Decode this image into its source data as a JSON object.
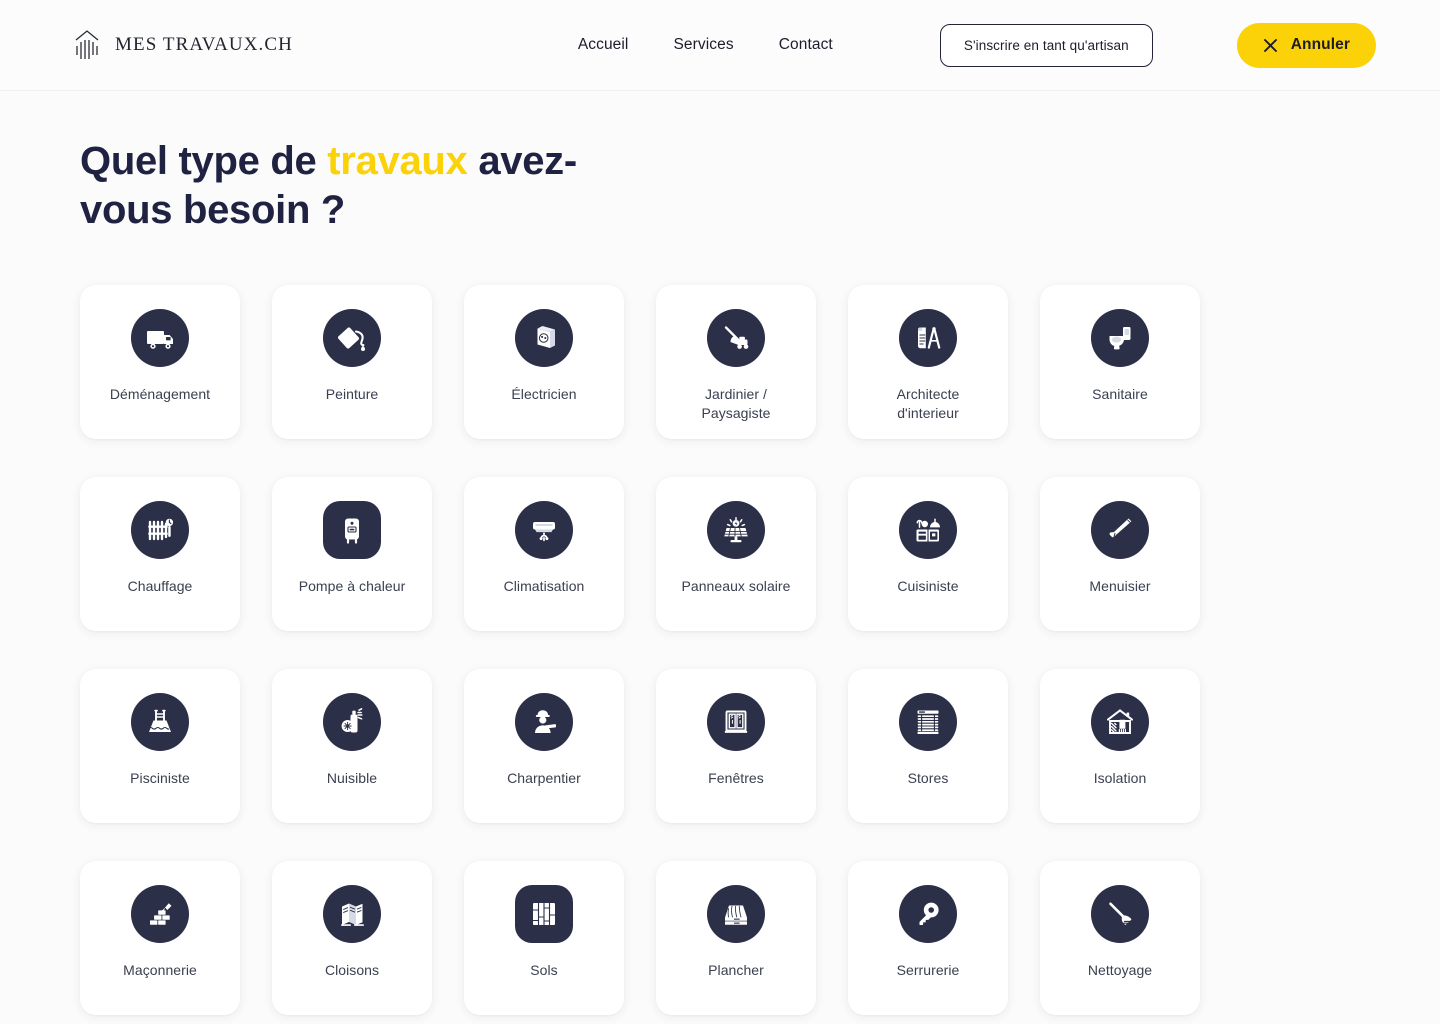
{
  "brand": {
    "name": "MES TRAVAUX.CH",
    "logo_icon": "building-icon"
  },
  "nav": {
    "links": [
      {
        "label": "Accueil",
        "name": "nav-link-accueil"
      },
      {
        "label": "Services",
        "name": "nav-link-services"
      },
      {
        "label": "Contact",
        "name": "nav-link-contact"
      }
    ],
    "signup_button": "S'inscrire en tant qu'artisan",
    "cancel_button": "Annuler",
    "cancel_icon": "close-icon"
  },
  "colors": {
    "accent_yellow": "#fad207",
    "icon_navy": "#2b2f47",
    "heading_navy": "#1f2240",
    "page_background": "#fbfbfc",
    "card_background": "#ffffff",
    "label_text": "#3b4050"
  },
  "main": {
    "title_part1": "Quel type de ",
    "title_accent": "travaux",
    "title_part2": " avez-vous besoin ?"
  },
  "categories": [
    {
      "label": "Déménagement",
      "icon": "moving-truck-icon",
      "shape": "circle"
    },
    {
      "label": "Peinture",
      "icon": "paint-can-icon",
      "shape": "circle"
    },
    {
      "label": "Électricien",
      "icon": "power-socket-icon",
      "shape": "circle"
    },
    {
      "label": "Jardinier /\nPaysagiste",
      "icon": "lawn-mower-icon",
      "shape": "circle"
    },
    {
      "label": "Architecte\nd'interieur",
      "icon": "blueprint-compass-icon",
      "shape": "circle"
    },
    {
      "label": "Sanitaire",
      "icon": "toilet-icon",
      "shape": "circle"
    },
    {
      "label": "Chauffage",
      "icon": "radiator-icon",
      "shape": "circle"
    },
    {
      "label": "Pompe à chaleur",
      "icon": "water-heater-icon",
      "shape": "squircle"
    },
    {
      "label": "Climatisation",
      "icon": "air-conditioner-icon",
      "shape": "circle"
    },
    {
      "label": "Panneaux solaire",
      "icon": "solar-panel-icon",
      "shape": "circle"
    },
    {
      "label": "Cuisiniste",
      "icon": "kitchen-counter-icon",
      "shape": "circle"
    },
    {
      "label": "Menuisier",
      "icon": "handsaw-icon",
      "shape": "circle"
    },
    {
      "label": "Pisciniste",
      "icon": "swimming-pool-icon",
      "shape": "circle"
    },
    {
      "label": "Nuisible",
      "icon": "pest-spray-icon",
      "shape": "circle"
    },
    {
      "label": "Charpentier",
      "icon": "carpenter-worker-icon",
      "shape": "circle"
    },
    {
      "label": "Fenêtres",
      "icon": "window-icon",
      "shape": "circle"
    },
    {
      "label": "Stores",
      "icon": "window-blinds-icon",
      "shape": "circle"
    },
    {
      "label": "Isolation",
      "icon": "house-insulation-icon",
      "shape": "circle"
    },
    {
      "label": "Maçonnerie",
      "icon": "brick-trowel-icon",
      "shape": "circle"
    },
    {
      "label": "Cloisons",
      "icon": "room-divider-icon",
      "shape": "circle"
    },
    {
      "label": "Sols",
      "icon": "floor-planks-icon",
      "shape": "squircle"
    },
    {
      "label": "Plancher",
      "icon": "wood-flooring-icon",
      "shape": "circle"
    },
    {
      "label": "Serrurerie",
      "icon": "key-icon",
      "shape": "circle"
    },
    {
      "label": "Nettoyage",
      "icon": "mop-icon",
      "shape": "circle"
    }
  ]
}
